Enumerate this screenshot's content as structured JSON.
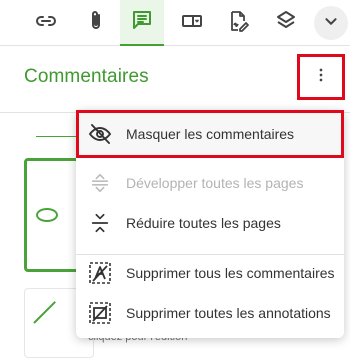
{
  "toolbar": {
    "icons": [
      "link-icon",
      "paperclip-icon",
      "comment-icon",
      "form-field-icon",
      "signature-icon",
      "layers-icon",
      "chevron-down-icon"
    ],
    "active": "comment-icon"
  },
  "panel": {
    "title": "Commentaires"
  },
  "menu": {
    "items": [
      {
        "label": "Masquer les commentaires",
        "icon": "eye-off-icon",
        "state": "highlighted"
      },
      {
        "label": "Développer toutes les pages",
        "icon": "expand-icon",
        "state": "disabled"
      },
      {
        "label": "Réduire toutes les pages",
        "icon": "collapse-icon",
        "state": "enabled"
      },
      {
        "label": "Supprimer tous les commentaires",
        "icon": "delete-comments-icon",
        "state": "enabled"
      },
      {
        "label": "Supprimer toutes les annotations",
        "icon": "delete-annotations-icon",
        "state": "enabled"
      }
    ]
  },
  "background": {
    "caption": "cliquez pour l'édition"
  },
  "colors": {
    "accent": "#3f9a2f",
    "highlight_border": "#e0081d",
    "active_tab_bg": "#eaf6e7"
  }
}
